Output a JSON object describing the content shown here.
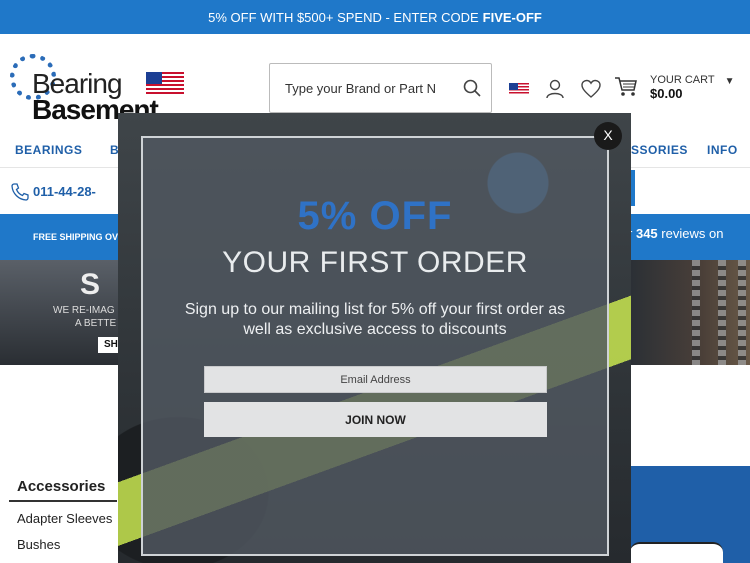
{
  "promo": {
    "text": "5% OFF WITH $500+ SPEND - ENTER CODE",
    "code": "FIVE-OFF"
  },
  "header": {
    "logo_line1": "Bearing",
    "logo_line2": "Basement",
    "search_placeholder": "Type your Brand or Part Number",
    "cart_label": "YOUR CART",
    "cart_total": "$0.00"
  },
  "nav": {
    "items": [
      "BEARINGS",
      "B",
      "SSORIES",
      "INFO"
    ]
  },
  "contact": {
    "phone": "011-44-28-"
  },
  "shipping": {
    "text": "FREE SHIPPING OV",
    "reviews_prefix": "r",
    "reviews_count": "345",
    "reviews_suffix": "reviews on"
  },
  "hero": {
    "big": "S",
    "line1": "WE RE-IMAG",
    "line2": "A BETTE",
    "button": "SH"
  },
  "sidebar": {
    "title": "Accessories",
    "links": [
      "Adapter Sleeves",
      "Bushes"
    ]
  },
  "modal": {
    "close": "X",
    "headline": "5% OFF",
    "subheadline": "YOUR FIRST ORDER",
    "description": "Sign up to our mailing list for 5% off your first order as well as exclusive access to discounts",
    "email_placeholder": "Email Address",
    "join_label": "JOIN NOW"
  },
  "colors": {
    "brand_blue": "#1f78c9",
    "nav_blue": "#1f5fa8",
    "modal_headline": "#2f72c6"
  },
  "icons": [
    "search-icon",
    "us-flag-icon",
    "user-icon",
    "heart-icon",
    "cart-icon",
    "chevron-down-icon",
    "phone-icon",
    "close-icon"
  ]
}
